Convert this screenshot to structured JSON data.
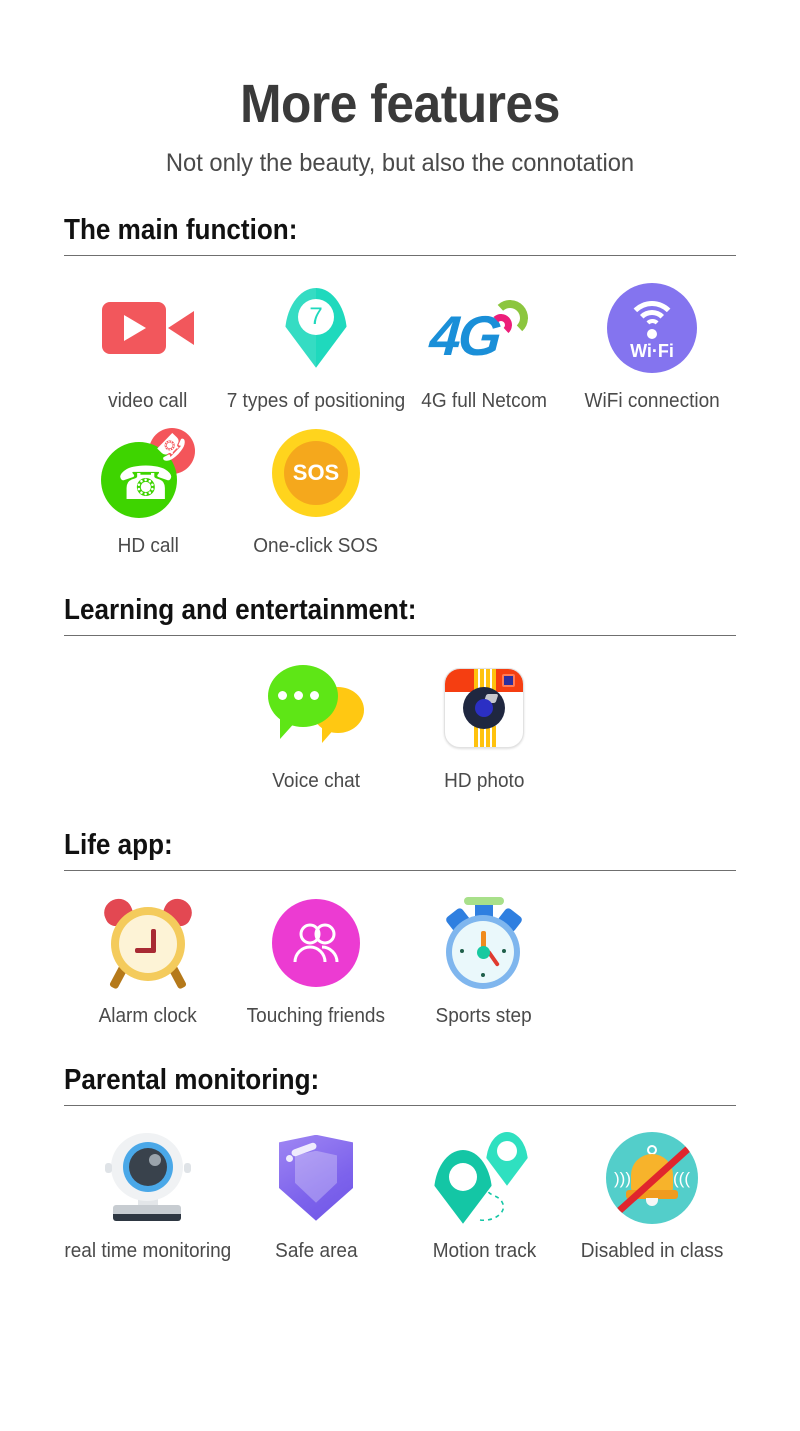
{
  "hero": {
    "title": "More features",
    "subtitle": "Not only the beauty, but also the connotation"
  },
  "sections": [
    {
      "heading": "The main function:",
      "rows": [
        [
          {
            "icon": "video-camera-icon",
            "label": "video call"
          },
          {
            "icon": "location-pin-7-icon",
            "label": "7 types of positioning",
            "badge": "7"
          },
          {
            "icon": "4g-signal-icon",
            "label": "4G full Netcom",
            "text": "4G"
          },
          {
            "icon": "wifi-circle-icon",
            "label": "WiFi connection",
            "text": "Wi·Fi"
          }
        ],
        [
          {
            "icon": "phone-call-icon",
            "label": "HD call"
          },
          {
            "icon": "sos-button-icon",
            "label": "One-click SOS",
            "text": "SOS"
          }
        ]
      ]
    },
    {
      "heading": "Learning and entertainment:",
      "rows": [
        [
          {
            "icon": "speech-bubble-icon",
            "label": "Voice chat"
          },
          {
            "icon": "camera-icon",
            "label": "HD photo"
          }
        ]
      ]
    },
    {
      "heading": "Life app:",
      "rows": [
        [
          {
            "icon": "alarm-clock-icon",
            "label": "Alarm clock"
          },
          {
            "icon": "friends-icon",
            "label": "Touching friends"
          },
          {
            "icon": "stopwatch-icon",
            "label": "Sports step"
          }
        ]
      ]
    },
    {
      "heading": "Parental monitoring:",
      "rows": [
        [
          {
            "icon": "webcam-icon",
            "label": "real time monitoring"
          },
          {
            "icon": "shield-icon",
            "label": "Safe area"
          },
          {
            "icon": "motion-track-icon",
            "label": "Motion track"
          },
          {
            "icon": "bell-disabled-icon",
            "label": "Disabled in class"
          }
        ]
      ]
    }
  ],
  "colors": {
    "video_red": "#f2575c",
    "pin_teal": "#1fd9bd",
    "blue_4g": "#1a8fd8",
    "pink_arc": "#ec1e79",
    "green_arc": "#8cc63e",
    "wifi_purple": "#8474ef",
    "call_green": "#3ed400",
    "call_red": "#f4555a",
    "sos_yellow": "#ffd41d",
    "sos_orange": "#f5a81c",
    "chat_green": "#5ee616",
    "chat_yellow": "#ffc812",
    "camera_red": "#f53e11",
    "camera_yellow": "#ffc20e",
    "clock_yellow": "#f4cb5c",
    "clock_red": "#e34852",
    "friends_magenta": "#ec3bd2",
    "stopwatch_blue": "#7fb6ee",
    "shield_purple": "#7d63ec",
    "track_teal": "#14c6a5",
    "bell_teal": "#53ceca",
    "bell_orange": "#f7b32b",
    "strike_red": "#e0262d",
    "heading_text": "#111111",
    "caption_text": "#4a4a4a",
    "rule": "#6f6f6f"
  }
}
